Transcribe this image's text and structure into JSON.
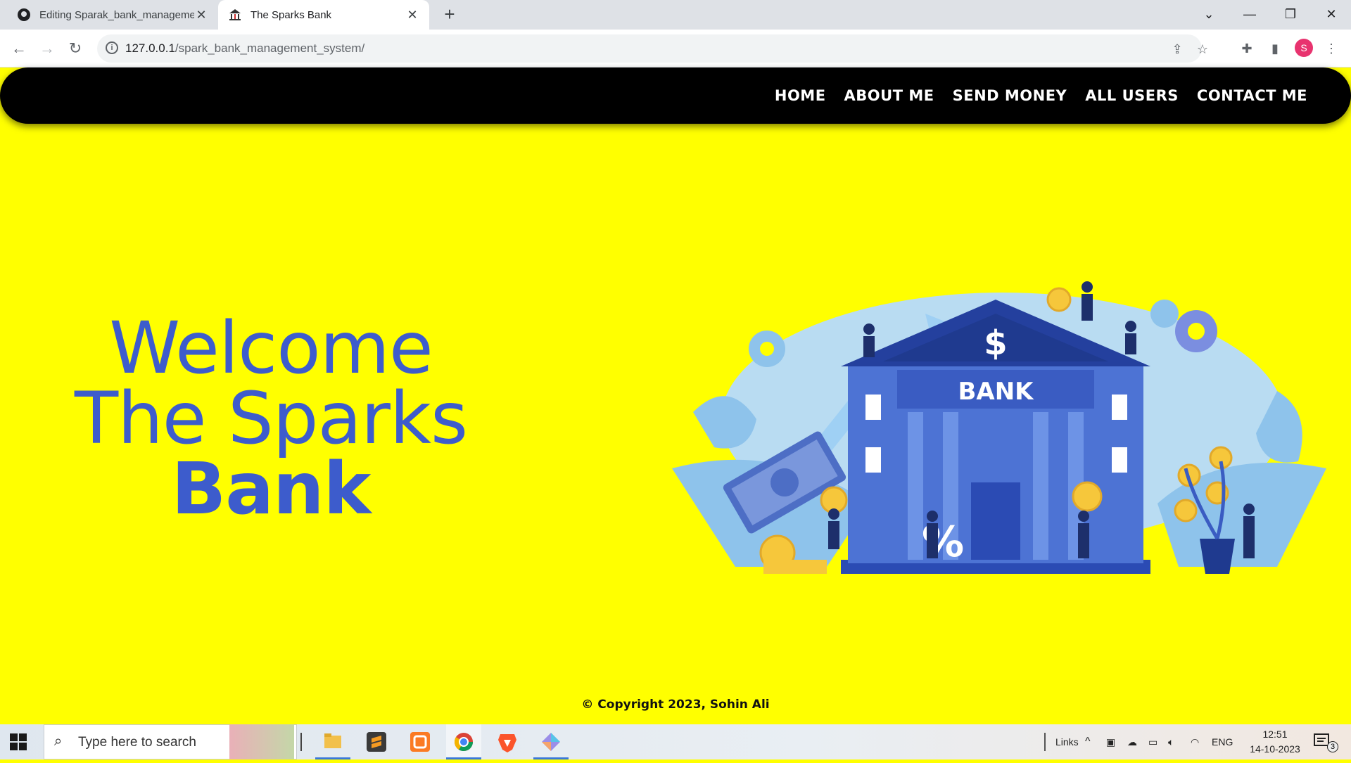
{
  "browser": {
    "tabs": [
      {
        "title": "Editing Sparak_bank_manageme",
        "active": false
      },
      {
        "title": "The Sparks Bank",
        "active": true
      }
    ],
    "url_host": "127.0.0.1",
    "url_path": "/spark_bank_management_system/",
    "profile_initial": "S"
  },
  "nav": {
    "items": [
      "HOME",
      "ABOUT ME",
      "SEND MONEY",
      "ALL USERS",
      "CONTACT ME"
    ]
  },
  "hero": {
    "line1": "Welcome",
    "line2": "The Sparks",
    "line3": "Bank"
  },
  "illustration": {
    "sign": "BANK",
    "dollar": "$",
    "percent": "%"
  },
  "footer": {
    "text": "© Copyright 2023, Sohin Ali"
  },
  "taskbar": {
    "search_placeholder": "Type here to search",
    "links_label": "Links",
    "language": "ENG",
    "time": "12:51",
    "date": "14-10-2023",
    "notification_count": "3"
  },
  "colors": {
    "page_bg": "#ffff00",
    "nav_bg": "#000000",
    "hero_text": "#3d5ccc"
  }
}
